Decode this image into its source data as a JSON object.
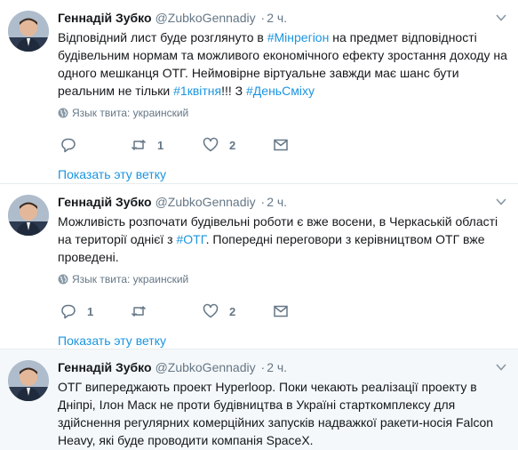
{
  "tweets": [
    {
      "name": "Геннадій Зубко",
      "handle": "@ZubkoGennadiy",
      "dot": "·",
      "time": "2 ч.",
      "text_parts": [
        {
          "t": "Відповідний лист буде розглянуто в ",
          "tag": false
        },
        {
          "t": "#Мінрегіон",
          "tag": true
        },
        {
          "t": " на предмет відповідності будівельним нормам та можливого економічного ефекту зростання доходу на одного мешканця ОТГ. Неймовірне віртуальне завжди має шанс бути реальним не тільки ",
          "tag": false
        },
        {
          "t": "#1квітня",
          "tag": true
        },
        {
          "t": "!!! З ",
          "tag": false
        },
        {
          "t": "#ДеньСміху",
          "tag": true
        }
      ],
      "lang": "Язык твита: украинский",
      "reply_count": "",
      "retweet_count": "1",
      "like_count": "2",
      "thread_link": "Показать эту ветку"
    },
    {
      "name": "Геннадій Зубко",
      "handle": "@ZubkoGennadiy",
      "dot": "·",
      "time": "2 ч.",
      "text_parts": [
        {
          "t": "Можливість розпочати будівельні роботи є вже восени, в Черкаській області на території однієї з ",
          "tag": false
        },
        {
          "t": "#ОТГ",
          "tag": true
        },
        {
          "t": ". Попередні переговори з керівництвом ОТГ вже проведені.",
          "tag": false
        }
      ],
      "lang": "Язык твита: украинский",
      "reply_count": "1",
      "retweet_count": "",
      "like_count": "2",
      "thread_link": "Показать эту ветку"
    },
    {
      "name": "Геннадій Зубко",
      "handle": "@ZubkoGennadiy",
      "dot": "·",
      "time": "2 ч.",
      "text_parts": [
        {
          "t": "ОТГ випереджають проект Hyperloop. Поки чекають реалізації проекту в Дніпрі, Ілон Маск не проти будівництва в Україні старткомплексу для здійснення регулярних комерційних запусків надважкої ракети-носія Falcon Heavy, які буде проводити компанія SpaceX.",
          "tag": false
        }
      ]
    }
  ],
  "icons": {
    "caret": "chevron-down-icon",
    "globe": "globe-icon",
    "reply": "reply-icon",
    "retweet": "retweet-icon",
    "like": "heart-icon",
    "dm": "envelope-icon"
  },
  "colors": {
    "link": "#1b95e0",
    "muted": "#657786",
    "text": "#14171a",
    "divider": "#e6ecf0",
    "highlight_bg": "#f5f8fa"
  }
}
